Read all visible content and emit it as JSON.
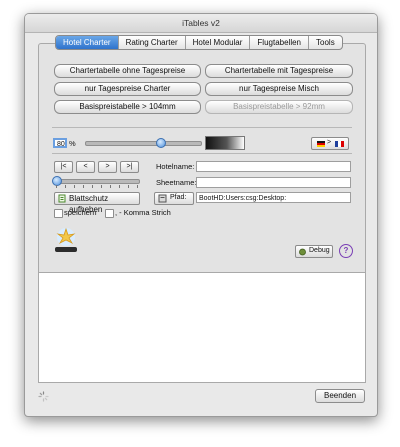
{
  "window": {
    "title": "iTables v2"
  },
  "tabs": [
    {
      "label": "Hotel Charter",
      "active": true
    },
    {
      "label": "Rating Charter",
      "active": false
    },
    {
      "label": "Hotel Modular",
      "active": false
    },
    {
      "label": "Flugtabellen",
      "active": false
    },
    {
      "label": "Tools",
      "active": false
    }
  ],
  "buttons": {
    "charter_ohne": "Chartertabelle ohne Tagespreise",
    "charter_mit": "Chartertabelle mit Tagespreise",
    "nur_charter": "nur Tagespreise Charter",
    "nur_misch": "nur Tagespreise Misch",
    "basis_104": "Basispreistabelle > 104mm",
    "basis_92": "Basispreistabelle > 92mm"
  },
  "zoom": {
    "value": "80",
    "unit": "%",
    "level": 0.65
  },
  "language": {
    "arrow": ">"
  },
  "nav": {
    "first": "|<",
    "prev": "<",
    "next": ">",
    "last": ">|"
  },
  "labels": {
    "hotelname": "Hotelname:",
    "sheetname": "Sheetname:"
  },
  "fields": {
    "hotelname": "",
    "sheetname": "",
    "pfad": "BootHD:Users:csg:Desktop:"
  },
  "blattschutz": "Blattschutz aufheben",
  "pfad_label": "Pfad:",
  "checkboxes": {
    "speichern": "speichern",
    "komma": ", - Komma Strich"
  },
  "debug_label": "Debug",
  "help_label": "?",
  "beenden_label": "Beenden",
  "colors": {
    "accent": "#3a7fd5",
    "help": "#7a3fb5"
  }
}
